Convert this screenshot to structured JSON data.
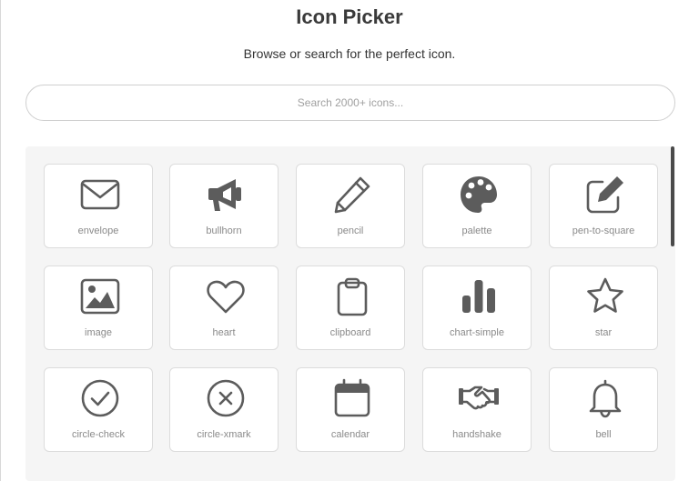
{
  "header": {
    "title": "Icon Picker",
    "subtitle": "Browse or search for the perfect icon."
  },
  "search": {
    "placeholder": "Search 2000+ icons...",
    "value": ""
  },
  "colors": {
    "icon": "#5c5c5c",
    "label": "#8a8a8a",
    "panel_background": "#f5f5f5",
    "tile_border": "#dcdcdc"
  },
  "icons": [
    {
      "label": "envelope",
      "icon": "envelope-icon"
    },
    {
      "label": "bullhorn",
      "icon": "bullhorn-icon"
    },
    {
      "label": "pencil",
      "icon": "pencil-icon"
    },
    {
      "label": "palette",
      "icon": "palette-icon"
    },
    {
      "label": "pen-to-square",
      "icon": "pen-to-square-icon"
    },
    {
      "label": "image",
      "icon": "image-icon"
    },
    {
      "label": "heart",
      "icon": "heart-icon"
    },
    {
      "label": "clipboard",
      "icon": "clipboard-icon"
    },
    {
      "label": "chart-simple",
      "icon": "chart-simple-icon"
    },
    {
      "label": "star",
      "icon": "star-icon"
    },
    {
      "label": "circle-check",
      "icon": "circle-check-icon"
    },
    {
      "label": "circle-xmark",
      "icon": "circle-xmark-icon"
    },
    {
      "label": "calendar",
      "icon": "calendar-icon"
    },
    {
      "label": "handshake",
      "icon": "handshake-icon"
    },
    {
      "label": "bell",
      "icon": "bell-icon"
    }
  ]
}
